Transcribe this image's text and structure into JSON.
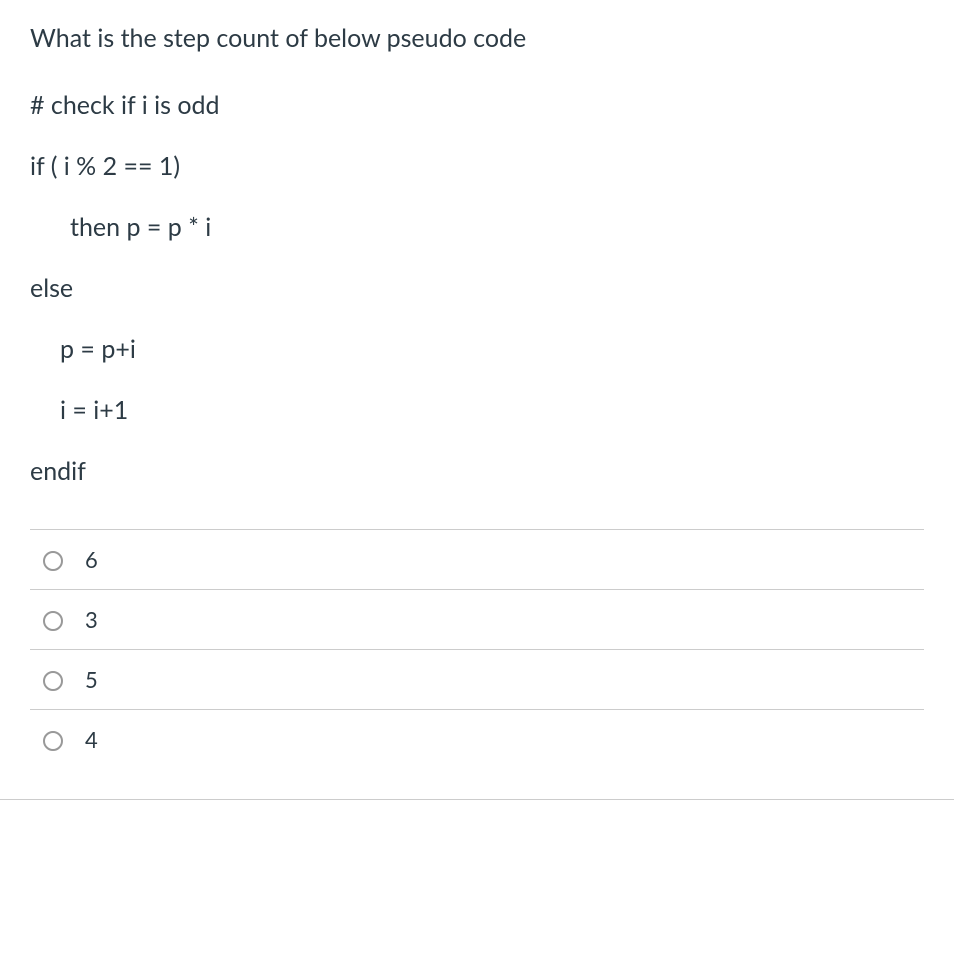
{
  "question": {
    "prompt": "What is the step count of below pseudo code",
    "code_lines": [
      {
        "text": "# check if i is odd",
        "indent": 1
      },
      {
        "text": "if ( i % 2 == 1)",
        "indent": 1
      },
      {
        "text": "then p = p * i",
        "indent": 2
      },
      {
        "text": "else",
        "indent": 1
      },
      {
        "text": "p = p+i",
        "indent": 3
      },
      {
        "text": "i = i+1",
        "indent": 3
      },
      {
        "text": "endif",
        "indent": 1
      }
    ]
  },
  "options": [
    {
      "label": "6"
    },
    {
      "label": "3"
    },
    {
      "label": "5"
    },
    {
      "label": "4"
    }
  ]
}
